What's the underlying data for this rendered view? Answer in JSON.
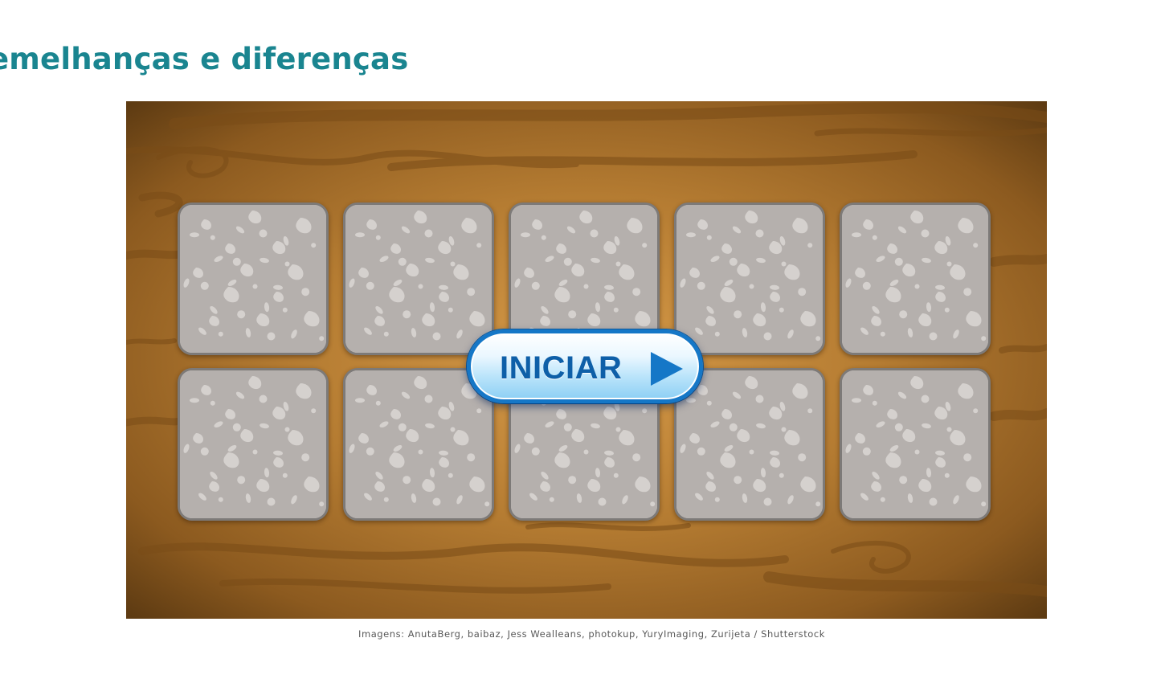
{
  "page": {
    "title": "emelhanças e diferenças",
    "credits": "Imagens: AnutaBerg, baibaz, Jess Wealleans, photokup, YuryImaging, Zurijeta / Shutterstock"
  },
  "game": {
    "board_icon": "wood-table-background",
    "cards": [
      {
        "state": "face-down"
      },
      {
        "state": "face-down"
      },
      {
        "state": "face-down"
      },
      {
        "state": "face-down"
      },
      {
        "state": "face-down"
      },
      {
        "state": "face-down"
      },
      {
        "state": "face-down"
      },
      {
        "state": "face-down"
      },
      {
        "state": "face-down"
      },
      {
        "state": "face-down"
      }
    ],
    "start_button": {
      "label": "INICIAR",
      "icon": "play-icon"
    }
  },
  "colors": {
    "title": "#1a8590",
    "button_border": "#1577c7",
    "button_text": "#0e5fa8",
    "card_back": "#b9b4b1",
    "wood": "#a66e28"
  }
}
